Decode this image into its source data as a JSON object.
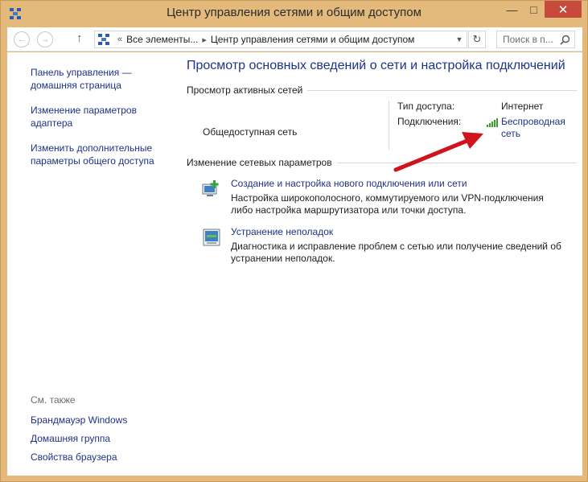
{
  "window": {
    "title": "Центр управления сетями и общим доступом"
  },
  "navbar": {
    "path_root": "Все элементы...",
    "path_current": "Центр управления сетями и общим доступом",
    "search_placeholder": "Поиск в п..."
  },
  "sidebar": {
    "links": [
      "Панель управления — домашняя страница",
      "Изменение параметров адаптера",
      "Изменить дополнительные параметры общего доступа"
    ],
    "see_also_title": "См. также",
    "see_also": [
      "Брандмауэр Windows",
      "Домашняя группа",
      "Свойства браузера"
    ]
  },
  "main": {
    "title": "Просмотр основных сведений о сети и настройка подключений",
    "active_networks_header": "Просмотр активных сетей",
    "network_name": "Общедоступная сеть",
    "access_type_label": "Тип доступа:",
    "access_type_value": "Интернет",
    "connections_label": "Подключения:",
    "connection_line1": "Беспроводная",
    "connection_line2": "сеть",
    "change_settings_header": "Изменение сетевых параметров",
    "tasks": [
      {
        "link": "Создание и настройка нового подключения или сети",
        "desc_line1": "Настройка широкополосного, коммутируемого или VPN-подключения",
        "desc_line2": "либо настройка маршрутизатора или точки доступа."
      },
      {
        "link": "Устранение неполадок",
        "desc_line1": "Диагностика и исправление проблем с сетью или получение сведений об",
        "desc_line2": "устранении неполадок."
      }
    ]
  },
  "colors": {
    "link": "#1e3287",
    "frame": "#e3b97c",
    "close": "#c74b3d",
    "arrow": "#d0141c",
    "signal": "#3a9a2a"
  }
}
